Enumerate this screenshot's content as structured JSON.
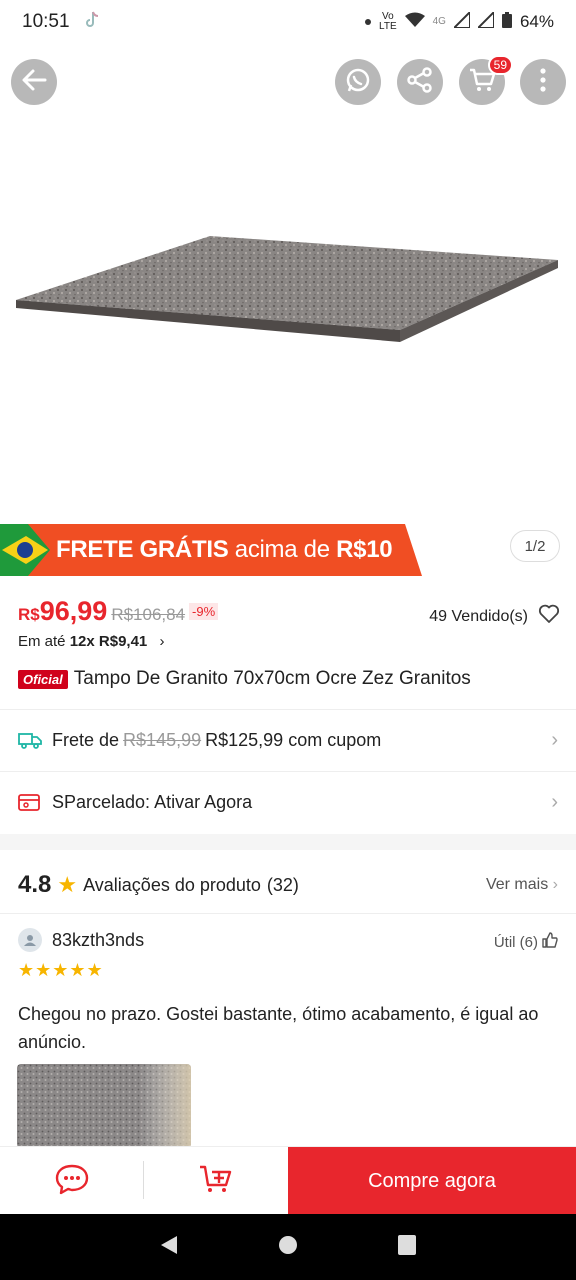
{
  "status_bar": {
    "time": "10:51",
    "network_top": "Vo",
    "network_bottom": "LTE",
    "network_4g": "4G",
    "battery": "64%"
  },
  "header": {
    "icons": [
      "back-arrow-icon",
      "whatsapp-icon",
      "share-icon",
      "cart-icon",
      "more-icon"
    ],
    "cart_count": "59"
  },
  "promo": {
    "text_bold": "FRETE GRÁTIS",
    "text_light": "acima de",
    "text_amount": "R$10",
    "page_indicator": "1/2"
  },
  "product": {
    "currency": "R$",
    "price": "96,99",
    "old_price": "R$106,84",
    "discount": "-9%",
    "sold": "49 Vendido(s)",
    "installments_prefix": "Em até",
    "installments_value": "12x R$9,41",
    "official_badge": "Oficial",
    "title": "Tampo De Granito 70x70cm Ocre Zez Granitos"
  },
  "shipping": {
    "prefix": "Frete de",
    "old": "R$145,99",
    "new": "R$125,99 com cupom"
  },
  "sparcelado": {
    "label": "SParcelado: Ativar Agora"
  },
  "reviews": {
    "rating": "4.8",
    "label": "Avaliações do produto",
    "count": "(32)",
    "see_more": "Ver mais",
    "review": {
      "user": "83kzth3nds",
      "useful": "Útil (6)",
      "stars": "★★★★★",
      "text": "Chegou no prazo. Gostei bastante, ótimo acabamento, é igual ao anúncio."
    }
  },
  "bottom_bar": {
    "buy_now": "Compre agora"
  },
  "colors": {
    "accent_red": "#e8262d",
    "promo_orange": "#f04e23",
    "star_yellow": "#f7b500"
  }
}
